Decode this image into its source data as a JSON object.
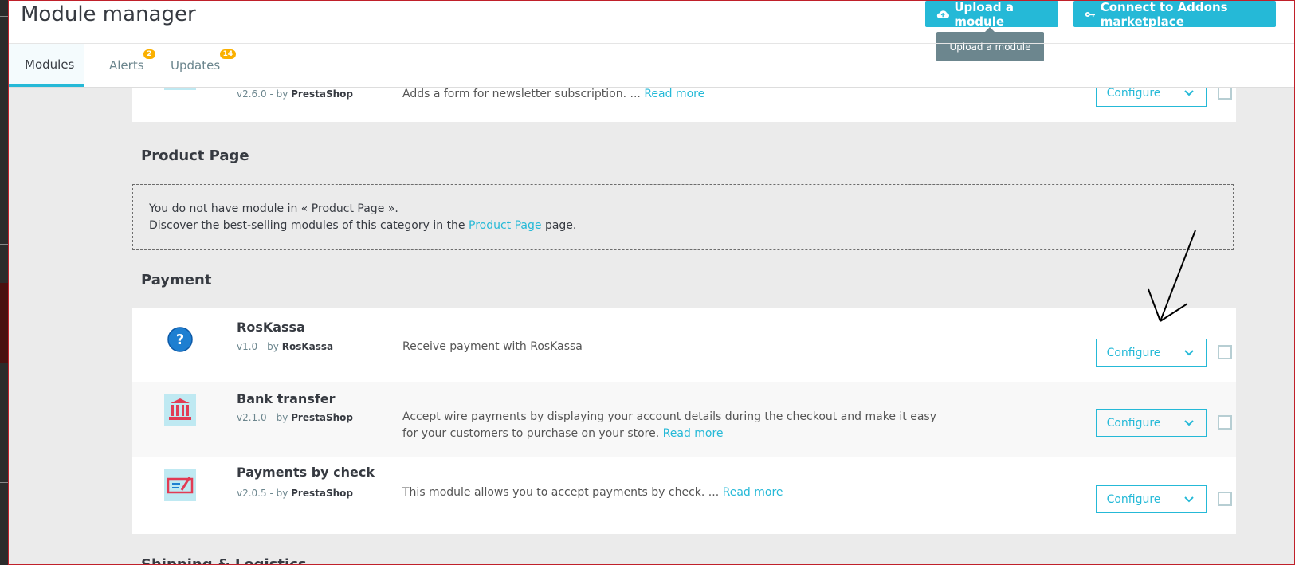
{
  "header": {
    "title": "Module manager",
    "upload_label": "Upload a module",
    "connect_label": "Connect to Addons marketplace",
    "tooltip": "Upload a module"
  },
  "tabs": [
    {
      "label": "Modules",
      "badge": ""
    },
    {
      "label": "Alerts",
      "badge": "2"
    },
    {
      "label": "Updates",
      "badge": "14"
    }
  ],
  "top_module": {
    "version": "v2.6.0 - by",
    "author": "PrestaShop",
    "description": "Adds a form for newsletter subscription. ...",
    "read_more": "Read more",
    "configure": "Configure"
  },
  "sections": {
    "product_page": {
      "title": "Product Page",
      "empty_line1": "You do not have module in « Product Page ».",
      "empty_line2_pre": "Discover the best-selling modules of this category in the",
      "empty_link": "Product Page",
      "empty_line2_post": "page."
    },
    "payment": {
      "title": "Payment",
      "modules": [
        {
          "name": "RosKassa",
          "version": "v1.0 - by",
          "author": "RosKassa",
          "description": "Receive payment with RosKassa",
          "read_more": "",
          "configure": "Configure"
        },
        {
          "name": "Bank transfer",
          "version": "v2.1.0 - by",
          "author": "PrestaShop",
          "description": "Accept wire payments by displaying your account details during the checkout and make it easy for your customers to purchase on your store.",
          "read_more": "Read more",
          "configure": "Configure"
        },
        {
          "name": "Payments by check",
          "version": "v2.0.5 - by",
          "author": "PrestaShop",
          "description": "This module allows you to accept payments by check. ...",
          "read_more": "Read more",
          "configure": "Configure"
        }
      ]
    },
    "next": {
      "title": "Shipping & Logistics"
    }
  },
  "colors": {
    "accent": "#25b9d7",
    "badge": "#fab000",
    "tooltip": "#6c868e"
  }
}
